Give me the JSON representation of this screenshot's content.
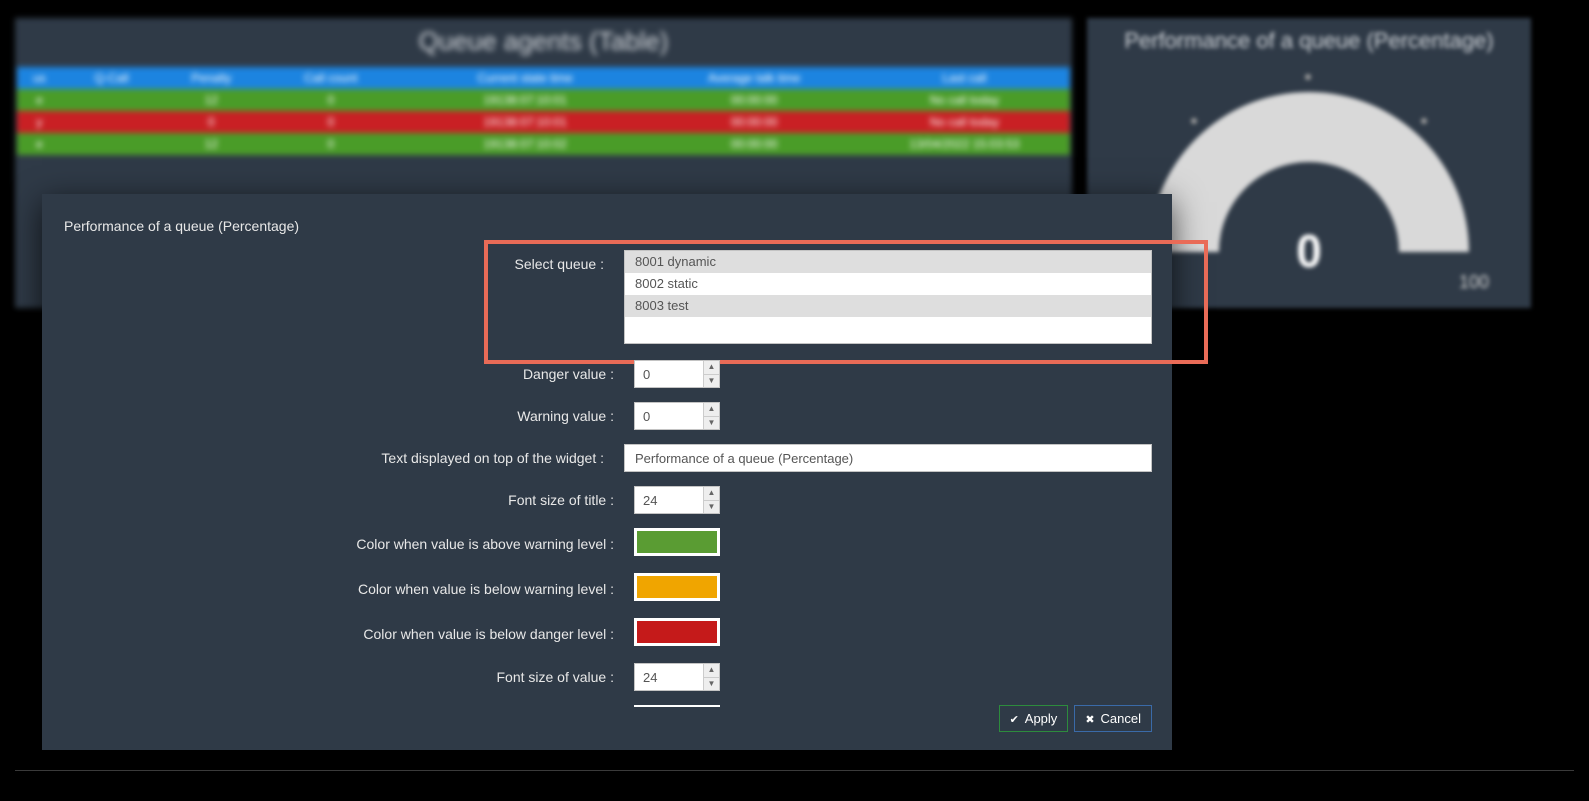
{
  "bg_table": {
    "title": "Queue agents (Table)",
    "headers": [
      "us",
      "Q-Call",
      "Penalty",
      "Call count",
      "Current state time",
      "Average talk time",
      "Last call"
    ],
    "rows": [
      {
        "cls": "row-green",
        "cells": [
          "e",
          "",
          "12",
          "0",
          "19138:07:10:01",
          "00:00:00",
          "No call today"
        ]
      },
      {
        "cls": "row-red",
        "cells": [
          "y",
          "",
          "0",
          "0",
          "19138:07:10:01",
          "00:00:00",
          "No call today"
        ]
      },
      {
        "cls": "row-green",
        "cells": [
          "e",
          "",
          "12",
          "0",
          "19138:07:10:02",
          "00:00:00",
          "13/04/2022 15:03:53"
        ]
      }
    ]
  },
  "bg_gauge": {
    "title": "Performance of a queue (Percentage)",
    "value": "0",
    "min": "0",
    "max": "100"
  },
  "modal": {
    "title": "Performance of a queue (Percentage)",
    "labels": {
      "select_queue": "Select queue :",
      "danger_value": "Danger value :",
      "warning_value": "Warning value :",
      "widget_text": "Text displayed on top of the widget :",
      "title_font": "Font size of title :",
      "color_above_warn": "Color when value is above warning level :",
      "color_below_warn": "Color when value is below warning level :",
      "color_below_danger": "Color when value is below danger level :",
      "value_font": "Font size of value :"
    },
    "queue_options": [
      {
        "text": "8001 dynamic",
        "shaded": true
      },
      {
        "text": "8002 static",
        "shaded": false
      },
      {
        "text": "8003 test",
        "shaded": true
      }
    ],
    "danger_value": "0",
    "warning_value": "0",
    "widget_text_value": "Performance of a queue (Percentage)",
    "title_font_value": "24",
    "value_font_value": "24",
    "colors": {
      "above_warn": "#5a9c33",
      "below_warn": "#f0a500",
      "below_danger": "#c51a1a"
    },
    "buttons": {
      "apply": "Apply",
      "cancel": "Cancel"
    }
  }
}
